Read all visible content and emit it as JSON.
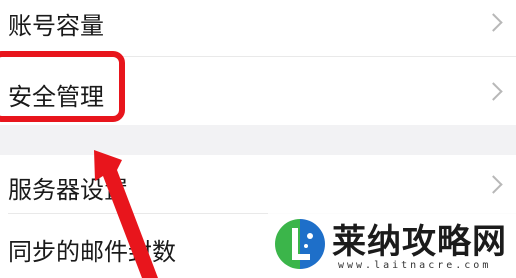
{
  "settings": {
    "items": [
      {
        "label": "账号容量"
      },
      {
        "label": "安全管理"
      },
      {
        "label": "服务器设置"
      },
      {
        "label": "同步的邮件封数"
      }
    ]
  },
  "annotation": {
    "highlight_color": "#e8151c"
  },
  "watermark": {
    "site_name": "莱纳攻略网",
    "url": "www.laitnacre.com",
    "colors": {
      "green": "#3bb54a",
      "blue": "#1e6fc9",
      "text": "#1b1b1b"
    }
  }
}
